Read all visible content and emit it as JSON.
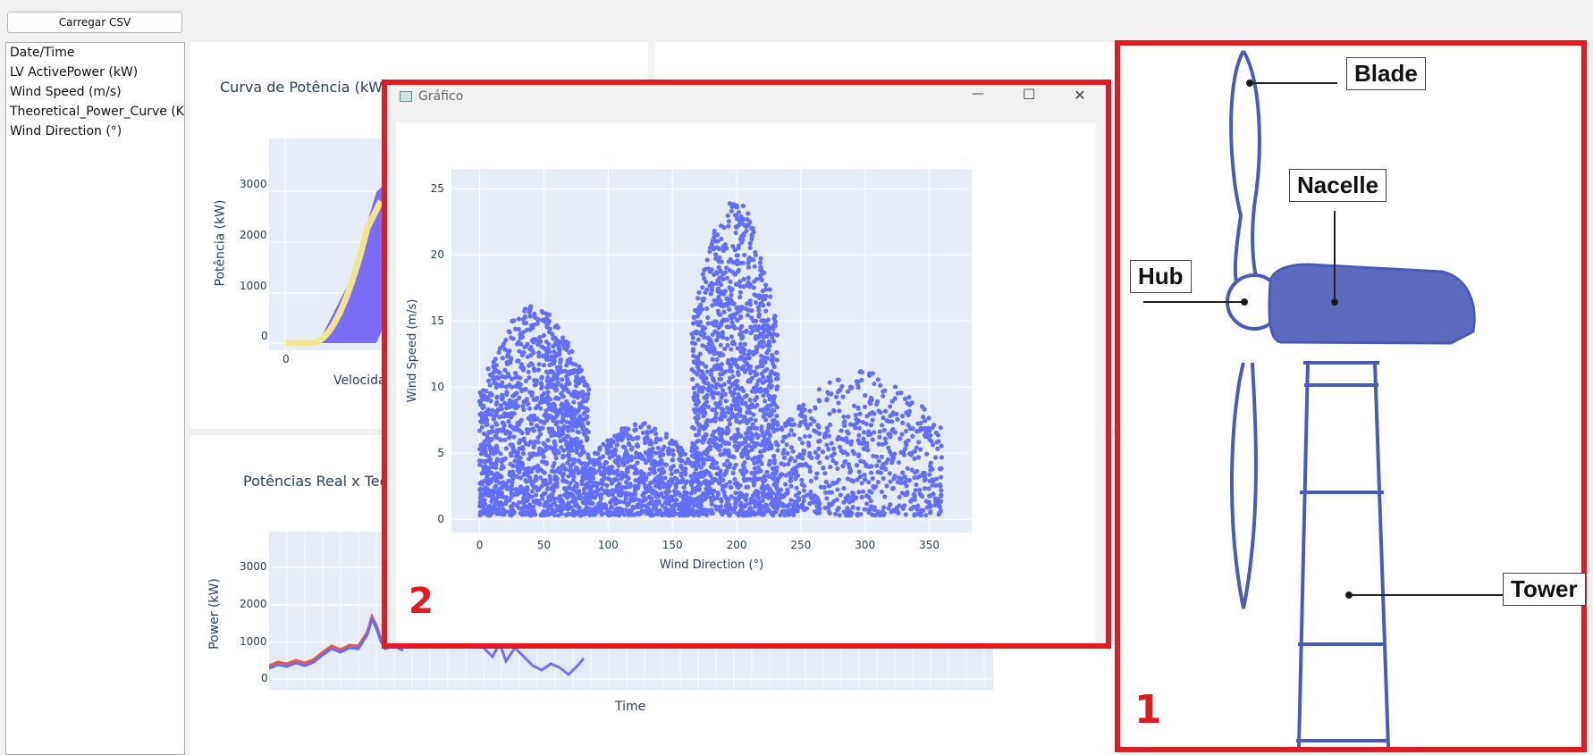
{
  "app": {
    "load_button": "Carregar CSV",
    "columns": [
      "Date/Time",
      "LV ActivePower (kW)",
      "Wind Speed (m/s)",
      "Theoretical_Power_Curve (KWh)",
      "Wind Direction (°)"
    ]
  },
  "power_curve_panel": {
    "title": "Curva de Potência (kW)",
    "ylabel": "Potência (kW)",
    "xlabel": "Velocidade",
    "yticks": [
      "3000",
      "2000",
      "1000",
      "0"
    ],
    "xticks": [
      "0"
    ],
    "colors": {
      "scatter": "#7b6cf6",
      "theoretical": "#f1e58d"
    }
  },
  "real_vs_theoretical_panel": {
    "title": "Potências Real x Teórica",
    "ylabel": "Power (kW)",
    "xlabel": "Time",
    "yticks": [
      "3000",
      "2000",
      "1000",
      "0"
    ],
    "colors": {
      "real": "#ef553b",
      "theoretical": "#636efa"
    }
  },
  "chart_window": {
    "title": "Gráfico",
    "controls": {
      "minimize": "—",
      "maximize": "☐",
      "close": "✕"
    }
  },
  "chart_data": {
    "type": "scatter",
    "title": "",
    "xlabel": "Wind Direction (°)",
    "ylabel": "Wind Speed (m/s)",
    "xlim": [
      -22,
      383
    ],
    "ylim": [
      -1,
      26.5
    ],
    "x_ticks": [
      0,
      50,
      100,
      150,
      200,
      250,
      300,
      350
    ],
    "y_ticks": [
      0,
      5,
      10,
      15,
      20,
      25
    ],
    "grid": true,
    "marker_color": "#636efa",
    "clusters": [
      {
        "x_range": [
          0,
          85
        ],
        "y_max": 16,
        "density": "dense"
      },
      {
        "x_range": [
          85,
          165
        ],
        "y_max": 7,
        "density": "medium"
      },
      {
        "x_range": [
          165,
          232
        ],
        "y_max": 24,
        "density": "dense"
      },
      {
        "x_range": [
          232,
          360
        ],
        "y_max": 11,
        "density": "medium"
      }
    ]
  },
  "turbine_diagram": {
    "labels": {
      "blade": "Blade",
      "nacelle": "Nacelle",
      "hub": "Hub",
      "tower": "Tower"
    },
    "colors": {
      "outline": "#4a5ab8",
      "nacelle_fill": "#5c6bc0"
    }
  },
  "markers": {
    "one": "1",
    "two": "2"
  }
}
